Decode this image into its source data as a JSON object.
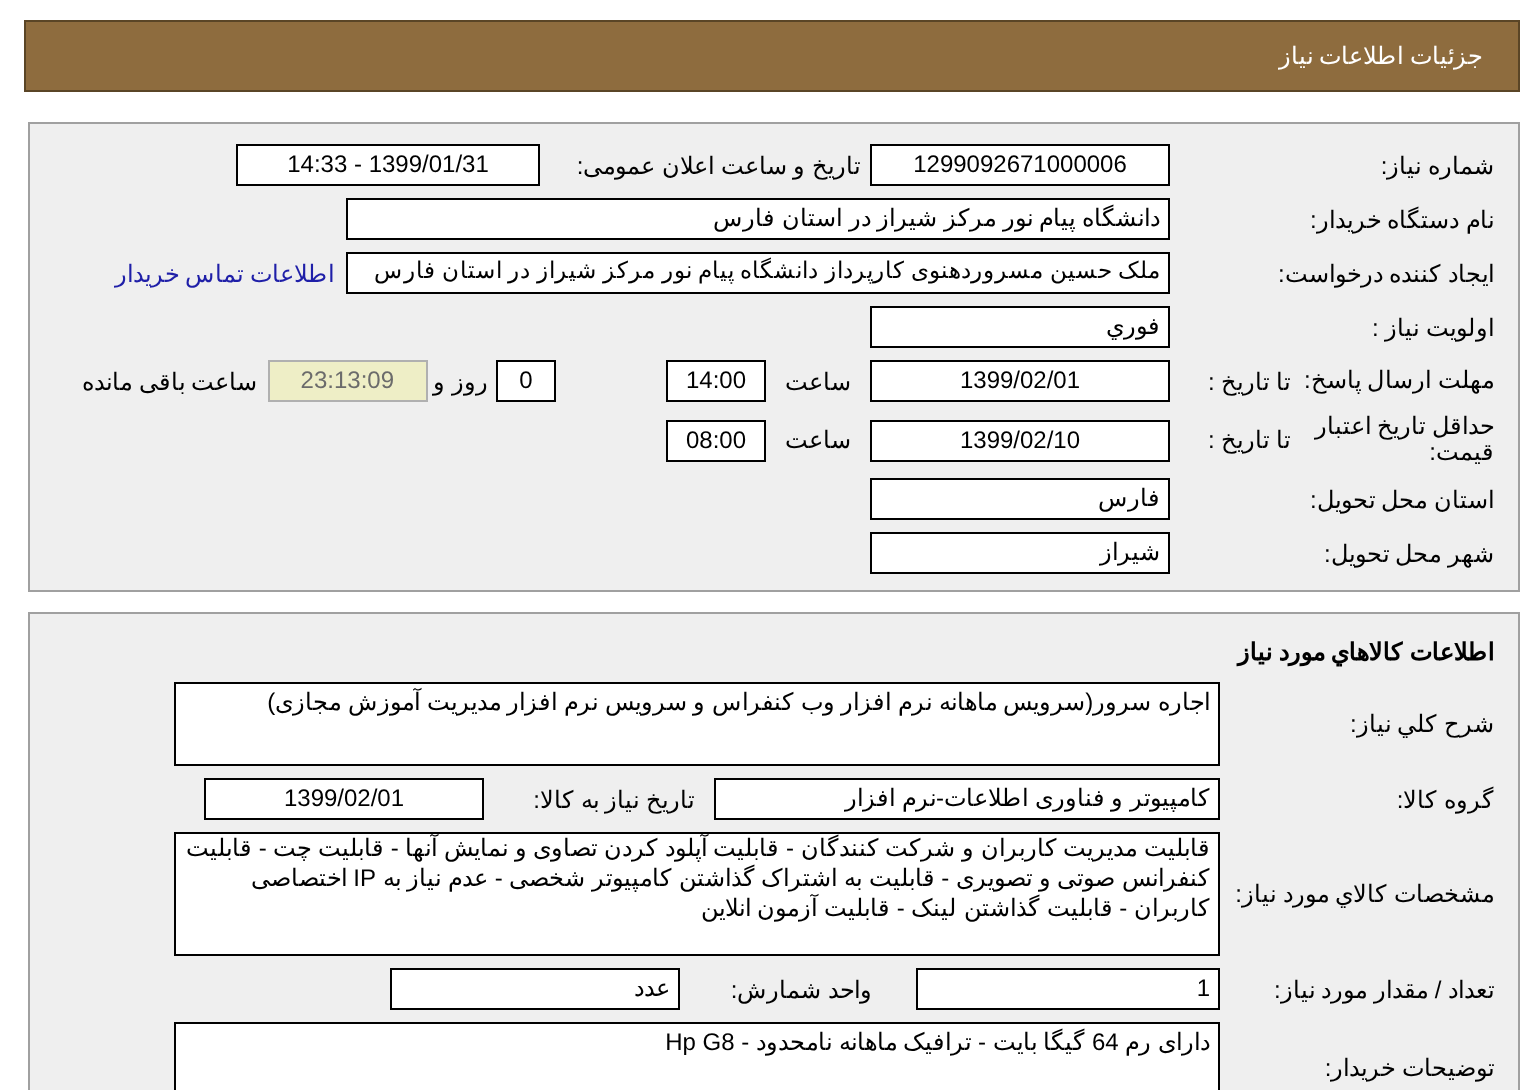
{
  "header": {
    "title": "جزئیات اطلاعات نیاز"
  },
  "details": {
    "need_number": {
      "label": "شماره نیاز:",
      "value": "1299092671000006"
    },
    "announce": {
      "label": "تاریخ و ساعت اعلان عمومی:",
      "value": "1399/01/31 - 14:33"
    },
    "buyer_org": {
      "label": "نام دستگاه خریدار:",
      "value": "دانشگاه پیام نور مرکز شیراز در استان فارس"
    },
    "requester": {
      "label": "ایجاد کننده درخواست:",
      "value": "ملک حسین مسروردهنوی کارپرداز دانشگاه پیام نور مرکز شیراز در استان فارس",
      "link": "اطلاعات تماس خریدار"
    },
    "priority": {
      "label": "اولویت نیاز :",
      "value": "فوري"
    },
    "reply_deadline": {
      "label": "مهلت ارسال پاسخ:",
      "to_date_label": "تا تاریخ :",
      "date": "1399/02/01",
      "time_label": "ساعت",
      "time": "14:00",
      "days": "0",
      "days_label": "روز و",
      "remaining": "23:13:09",
      "remaining_label": "ساعت باقی مانده"
    },
    "price_validity": {
      "label": "حداقل تاریخ اعتبار قیمت:",
      "to_date_label": "تا تاریخ :",
      "date": "1399/02/10",
      "time_label": "ساعت",
      "time": "08:00"
    },
    "province": {
      "label": "استان محل تحویل:",
      "value": "فارس"
    },
    "city": {
      "label": "شهر محل تحویل:",
      "value": "شیراز"
    }
  },
  "goods": {
    "title": "اطلاعات کالاهاي مورد نیاز",
    "description": {
      "label": "شرح کلي نیاز:",
      "value": "اجاره سرور(سرویس ماهانه نرم افزار وب کنفراس و سرویس نرم افزار مدیریت آموزش مجازی)"
    },
    "group": {
      "label": "گروه کالا:",
      "value": "کامپیوتر و فناوری اطلاعات-نرم افزار",
      "date_label": "تاریخ نیاز به کالا:",
      "date": "1399/02/01"
    },
    "specs": {
      "label": "مشخصات کالاي مورد نیاز:",
      "value": "قابلیت مدیریت کاربران و شرکت کنندگان - قابلیت آپلود کردن تصاوی و نمایش آنها - قابلیت چت - قابلیت کنفرانس صوتی و تصویری - قابلیت به اشتراک گذاشتن کامپیوتر شخصی - عدم نیاز به IP اختصاصی کاربران - قابلیت گذاشتن لینک - قابلیت آزمون انلاین"
    },
    "quantity": {
      "label": "تعداد / مقدار مورد نیاز:",
      "value": "1",
      "unit_label": "واحد شمارش:",
      "unit": "عدد"
    },
    "buyer_notes": {
      "label": "توضیحات خریدار:",
      "value": "دارای رم 64 گیگا بایت - ترافیک ماهانه نامحدود - Hp G8"
    }
  }
}
